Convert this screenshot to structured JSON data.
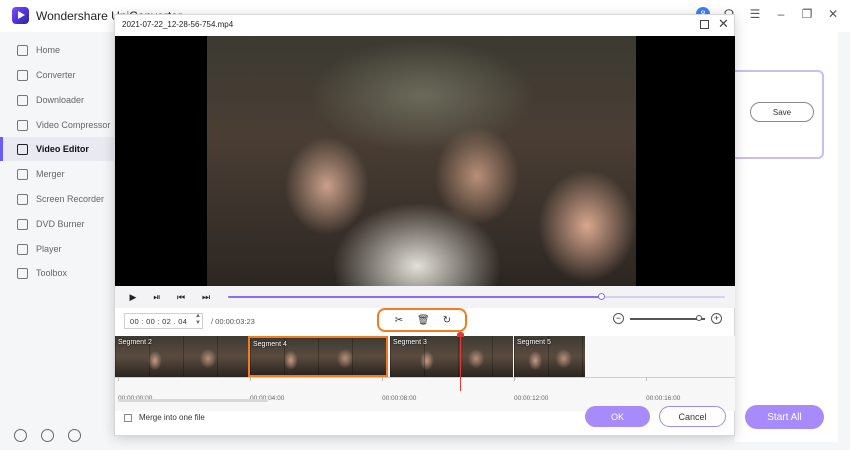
{
  "app": {
    "title": "Wondershare UniConverter",
    "avatar_letter": "8"
  },
  "sidebar": {
    "items": [
      {
        "label": "Home"
      },
      {
        "label": "Converter"
      },
      {
        "label": "Downloader"
      },
      {
        "label": "Video Compressor"
      },
      {
        "label": "Video Editor",
        "active": true
      },
      {
        "label": "Merger"
      },
      {
        "label": "Screen Recorder"
      },
      {
        "label": "DVD Burner"
      },
      {
        "label": "Player"
      },
      {
        "label": "Toolbox"
      }
    ]
  },
  "background": {
    "save_label": "Save",
    "start_all_label": "Start All"
  },
  "dialog": {
    "filename": "2021-07-22_12-28-56-754.mp4",
    "current_time": "00 : 00 : 02 . 04",
    "total_time": "/ 00:00:03:23",
    "progress_fraction": 0.75,
    "zoom_fraction": 0.92,
    "segments": [
      {
        "label": "Segment 2"
      },
      {
        "label": "Segment 4"
      },
      {
        "label": "Segment 3"
      },
      {
        "label": "Segment 5"
      }
    ],
    "ruler_labels": [
      "00:00:00:00",
      "00:00:04:00",
      "00:00:08:00",
      "00:00:12:00",
      "00:00:16:00"
    ],
    "merge_label": "Merge into one file",
    "ok_label": "OK",
    "cancel_label": "Cancel"
  },
  "colors": {
    "accent": "#8b6cf5",
    "highlight": "#f47c20",
    "playhead": "#e53935"
  }
}
